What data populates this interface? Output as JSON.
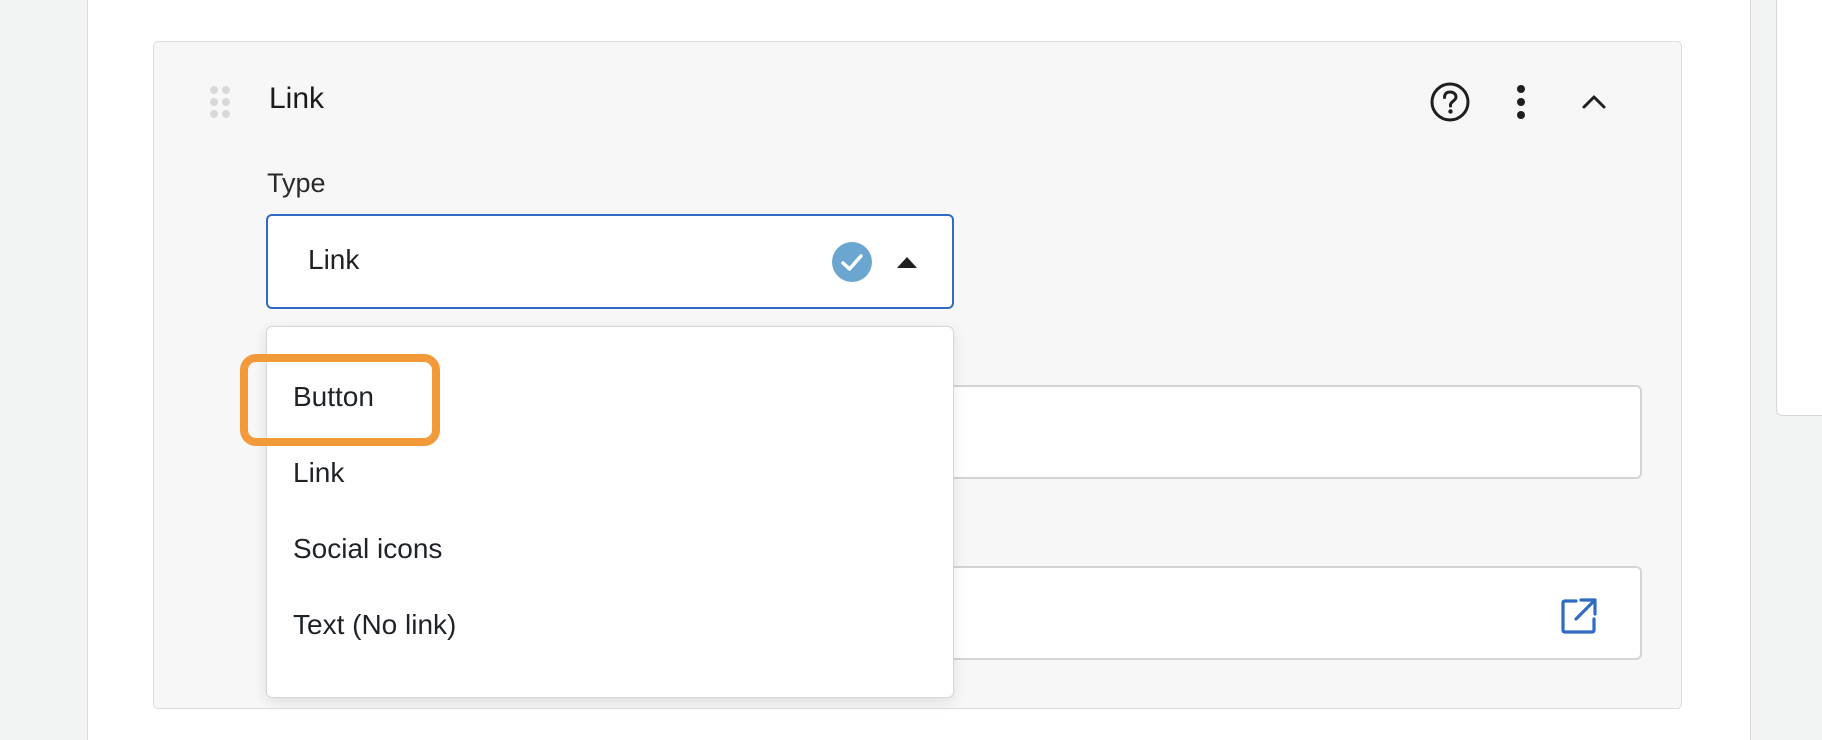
{
  "block": {
    "title": "Link"
  },
  "type_field": {
    "label": "Type",
    "selected_value": "Link",
    "options": [
      {
        "label": "Button"
      },
      {
        "label": "Link"
      },
      {
        "label": "Social icons"
      },
      {
        "label": "Text (No link)"
      }
    ],
    "highlighted_option": "Button"
  },
  "icons": {
    "drag": "drag-handle-icon",
    "help": "help-circle-icon",
    "more": "more-vertical-icon",
    "collapse": "chevron-up-icon",
    "valid": "check-circle-icon",
    "caret": "caret-up-icon",
    "external": "external-link-icon"
  },
  "colors": {
    "accent": "#2f6bc4",
    "valid_check": "#6aa6cf",
    "highlight": "#f29a3a"
  }
}
